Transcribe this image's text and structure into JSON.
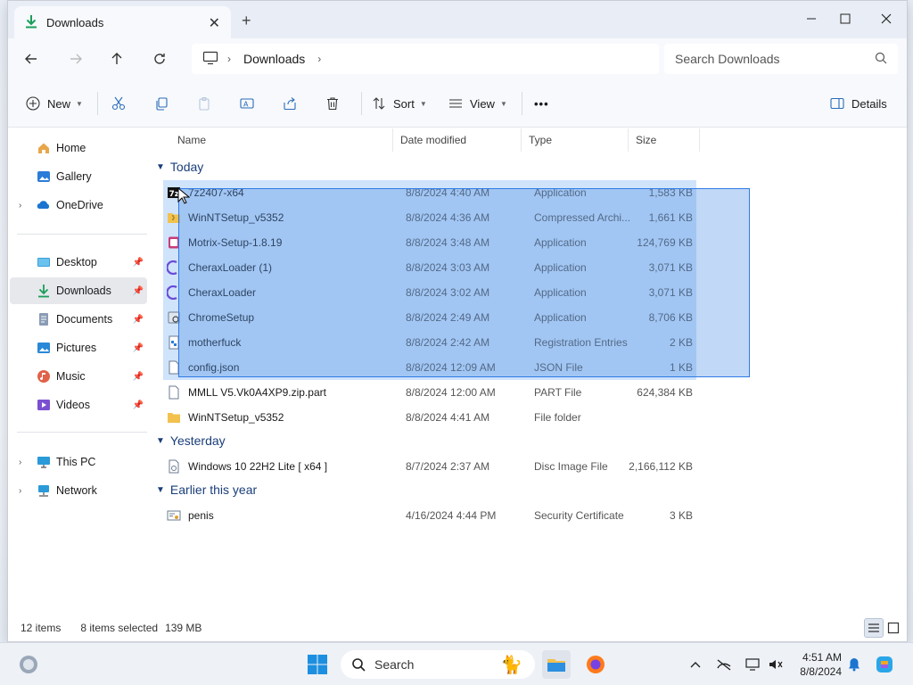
{
  "window": {
    "tab_title": "Downloads",
    "tab_close": "✕",
    "new_tab": "+",
    "minimize": "—",
    "maximize": "☐",
    "close": "✕"
  },
  "address": {
    "breadcrumb": [
      "Downloads"
    ],
    "search_placeholder": "Search Downloads"
  },
  "toolbar": {
    "new_label": "New",
    "sort_label": "Sort",
    "view_label": "View",
    "more_label": "•••",
    "details_label": "Details",
    "icons": [
      "cut-icon",
      "copy-icon",
      "paste-icon",
      "rename-icon",
      "share-icon",
      "delete-icon"
    ]
  },
  "sidebar": {
    "items": [
      {
        "label": "Home",
        "icon": "home-icon"
      },
      {
        "label": "Gallery",
        "icon": "gallery-icon"
      },
      {
        "label": "OneDrive",
        "icon": "onedrive-icon"
      },
      {
        "label": "Desktop",
        "icon": "desktop-icon"
      },
      {
        "label": "Downloads",
        "icon": "downloads-icon"
      },
      {
        "label": "Documents",
        "icon": "documents-icon"
      },
      {
        "label": "Pictures",
        "icon": "pictures-icon"
      },
      {
        "label": "Music",
        "icon": "music-icon"
      },
      {
        "label": "Videos",
        "icon": "videos-icon"
      },
      {
        "label": "This PC",
        "icon": "this-pc-icon"
      },
      {
        "label": "Network",
        "icon": "network-icon"
      }
    ]
  },
  "columns": {
    "name": "Name",
    "date": "Date modified",
    "type": "Type",
    "size": "Size"
  },
  "groups": {
    "today": "Today",
    "yesterday": "Yesterday",
    "earlier": "Earlier this year"
  },
  "files": [
    {
      "name": "7z2407-x64",
      "date": "8/8/2024 4:40 AM",
      "type": "Application",
      "size": "1,583 KB",
      "selected": true,
      "icon": "7zip-icon"
    },
    {
      "name": "WinNTSetup_v5352",
      "date": "8/8/2024 4:36 AM",
      "type": "Compressed Archi...",
      "size": "1,661 KB",
      "selected": true,
      "icon": "zip-folder-icon"
    },
    {
      "name": "Motrix-Setup-1.8.19",
      "date": "8/8/2024 3:48 AM",
      "type": "Application",
      "size": "124,769 KB",
      "selected": true,
      "icon": "installer-icon"
    },
    {
      "name": "CheraxLoader (1)",
      "date": "8/8/2024 3:03 AM",
      "type": "Application",
      "size": "3,071 KB",
      "selected": true,
      "icon": "cherax-icon"
    },
    {
      "name": "CheraxLoader",
      "date": "8/8/2024 3:02 AM",
      "type": "Application",
      "size": "3,071 KB",
      "selected": true,
      "icon": "cherax-icon"
    },
    {
      "name": "ChromeSetup",
      "date": "8/8/2024 2:49 AM",
      "type": "Application",
      "size": "8,706 KB",
      "selected": true,
      "icon": "setup-icon"
    },
    {
      "name": "motherfuck",
      "date": "8/8/2024 2:42 AM",
      "type": "Registration Entries",
      "size": "2 KB",
      "selected": true,
      "icon": "registry-icon"
    },
    {
      "name": "config.json",
      "date": "8/8/2024 12:09 AM",
      "type": "JSON File",
      "size": "1 KB",
      "selected": true,
      "icon": "file-icon"
    },
    {
      "name": "MMLL V5.Vk0A4XP9.zip.part",
      "date": "8/8/2024 12:00 AM",
      "type": "PART File",
      "size": "624,384 KB",
      "selected": false,
      "icon": "file-icon"
    },
    {
      "name": "WinNTSetup_v5352",
      "date": "8/8/2024 4:41 AM",
      "type": "File folder",
      "size": "",
      "selected": false,
      "icon": "folder-icon"
    },
    {
      "name": "Windows 10 22H2 Lite [ x64 ]",
      "date": "8/7/2024 2:37 AM",
      "type": "Disc Image File",
      "size": "2,166,112 KB",
      "selected": false,
      "icon": "disc-image-icon"
    },
    {
      "name": "penis",
      "date": "4/16/2024 4:44 PM",
      "type": "Security Certificate",
      "size": "3 KB",
      "selected": false,
      "icon": "certificate-icon"
    }
  ],
  "status": {
    "items_count": "12 items",
    "selected_count": "8 items selected",
    "selected_size": "139 MB"
  },
  "taskbar": {
    "search_label": "Search",
    "time": "4:51 AM",
    "date": "8/8/2024"
  },
  "colors": {
    "accent": "#0067c0",
    "selection": "#cfe3fb",
    "marquee": "#2f7ae5",
    "group_header": "#1a3e7a"
  }
}
